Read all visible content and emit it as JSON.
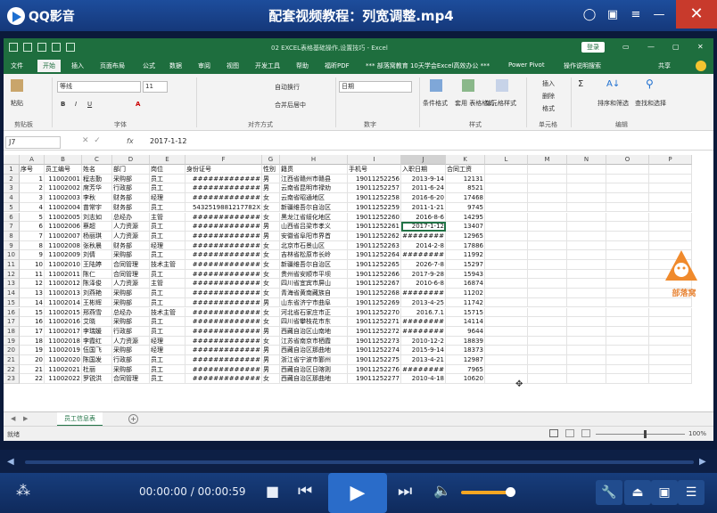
{
  "player": {
    "app_name": "QQ影音",
    "video_title": "配套视频教程：列宽调整.mp4",
    "time_current": "00:00:00",
    "time_total": "/ 00:00:59"
  },
  "excel": {
    "window_title": "02 EXCEL表格基础操作,设置技巧 - Excel",
    "login": "登录",
    "tabs": [
      "文件",
      "开始",
      "插入",
      "页面布局",
      "公式",
      "数据",
      "审阅",
      "视图",
      "开发工具",
      "帮助",
      "福昕PDF",
      "*** 部落窝教育 10天学会Excel高效办公 ***",
      "Power Pivot",
      "操作说明搜索",
      "共享"
    ],
    "ribbon": {
      "clipboard": {
        "paste": "粘贴",
        "group": "剪贴板"
      },
      "font": {
        "name": "等线",
        "size": "11",
        "group": "字体"
      },
      "align": {
        "wrap": "自动换行",
        "merge": "合并后居中",
        "group": "对齐方式"
      },
      "number": {
        "format": "日期",
        "group": "数字"
      },
      "styles": {
        "cond": "条件格式",
        "table": "套用\n表格格式",
        "cell": "单元格样式",
        "group": "样式"
      },
      "cells": {
        "insert": "插入",
        "delete": "删除",
        "format": "格式",
        "group": "单元格"
      },
      "editing": {
        "sort": "排序和筛选",
        "find": "查找和选择",
        "group": "编辑"
      }
    },
    "namebox": "J7",
    "formula": "2017-1-12",
    "columns": [
      "A",
      "B",
      "C",
      "D",
      "E",
      "F",
      "G",
      "H",
      "I",
      "J",
      "K",
      "L",
      "M",
      "N",
      "O",
      "P"
    ],
    "header_row": [
      "序号",
      "员工编号",
      "姓名",
      "部门",
      "岗位",
      "身份证号",
      "性别",
      "籍贯",
      "手机号",
      "入职日期",
      "合同工资"
    ],
    "rows": [
      [
        "1",
        "11002001",
        "程志勤",
        "采购部",
        "员工",
        "#############",
        "男",
        "江西省赣州市赣县",
        "19011252256",
        "2013-9-14",
        "12131"
      ],
      [
        "2",
        "11002002",
        "席芳华",
        "行政部",
        "员工",
        "#############",
        "男",
        "云南省昆明市禄劝",
        "19011252257",
        "2011-6-24",
        "8521"
      ],
      [
        "3",
        "11002003",
        "李秋",
        "财务部",
        "经理",
        "#############",
        "女",
        "云南省昭通地区",
        "19011252258",
        "2016-6-20",
        "17468"
      ],
      [
        "4",
        "11002004",
        "苗常宇",
        "财务部",
        "员工",
        "5432519881217782X",
        "女",
        "新疆维吾尔自治区",
        "19011252259",
        "2011-1-21",
        "9745"
      ],
      [
        "5",
        "11002005",
        "刘志如",
        "总经办",
        "主管",
        "#############",
        "女",
        "黑龙江省绥化地区",
        "19011252260",
        "2016-8-6",
        "14295"
      ],
      [
        "6",
        "11002006",
        "蔡超",
        "人力资源",
        "员工",
        "#############",
        "男",
        "山西省吕梁市孝义",
        "19011252261",
        "2017-1-12",
        "13407"
      ],
      [
        "7",
        "11002007",
        "杨丽琪",
        "人力资源",
        "员工",
        "#############",
        "男",
        "安徽省阜阳市界首",
        "19011252262",
        "########",
        "12965"
      ],
      [
        "8",
        "11002008",
        "张秋晨",
        "财务部",
        "经理",
        "#############",
        "女",
        "北京市石景山区",
        "19011252263",
        "2014-2-8",
        "17886"
      ],
      [
        "9",
        "11002009",
        "刘倩",
        "采购部",
        "员工",
        "#############",
        "女",
        "吉林省松原市长岭",
        "19011252264",
        "########",
        "11992"
      ],
      [
        "10",
        "11002010",
        "王陆婷",
        "合同管理",
        "技术主管",
        "#############",
        "女",
        "新疆维吾尔自治区",
        "19011252265",
        "2026-7-8",
        "15297"
      ],
      [
        "11",
        "11002011",
        "陈仁",
        "合同管理",
        "员工",
        "#############",
        "女",
        "贵州省安顺市平坝",
        "19011252266",
        "2017-9-28",
        "15943"
      ],
      [
        "12",
        "11002012",
        "陈泽俊",
        "人力资源",
        "主管",
        "#############",
        "女",
        "四川省宜宾市屏山",
        "19011252267",
        "2010-6-8",
        "16874"
      ],
      [
        "13",
        "11002013",
        "刘燕艳",
        "采购部",
        "员工",
        "#############",
        "女",
        "青海省黄南藏族自",
        "19011252268",
        "########",
        "11202"
      ],
      [
        "14",
        "11002014",
        "王彬辉",
        "采购部",
        "员工",
        "#############",
        "男",
        "山东省济宁市曲阜",
        "19011252269",
        "2013-4-25",
        "11742"
      ],
      [
        "15",
        "11002015",
        "邢燕雪",
        "总经办",
        "技术主管",
        "#############",
        "女",
        "河北省石家庄市正",
        "19011252270",
        "2016.7.1",
        "15715"
      ],
      [
        "16",
        "11002016",
        "艾晓",
        "采购部",
        "员工",
        "#############",
        "女",
        "四川省攀枝花市东",
        "19011252271",
        "########",
        "14114"
      ],
      [
        "17",
        "11002017",
        "李瑞媛",
        "行政部",
        "员工",
        "#############",
        "男",
        "西藏自治区山南地",
        "19011252272",
        "########",
        "9644"
      ],
      [
        "18",
        "11002018",
        "李霞红",
        "人力资源",
        "经理",
        "#############",
        "女",
        "江苏省南京市栖霞",
        "19011252273",
        "2010-12-2",
        "18839"
      ],
      [
        "19",
        "11002019",
        "伍国飞",
        "采购部",
        "经理",
        "#############",
        "男",
        "西藏自治区那曲地",
        "19011252274",
        "2015-9-14",
        "18373"
      ],
      [
        "20",
        "11002020",
        "陈国发",
        "行政部",
        "员工",
        "#############",
        "男",
        "浙江省宁波市鄞州",
        "19011252275",
        "2013-4-21",
        "12987"
      ],
      [
        "21",
        "11002021",
        "杜丽",
        "采购部",
        "员工",
        "#############",
        "男",
        "西藏自治区日喀则",
        "19011252276",
        "########",
        "7965"
      ],
      [
        "22",
        "11002022",
        "罗锐洪",
        "合同管理",
        "员工",
        "#############",
        "女",
        "西藏自治区那曲地",
        "19011252277",
        "2010-4-18",
        "10620"
      ]
    ],
    "sheet_tab": "员工信息表",
    "status": "就绪",
    "zoom": "100%",
    "watermark": "部落窝"
  }
}
